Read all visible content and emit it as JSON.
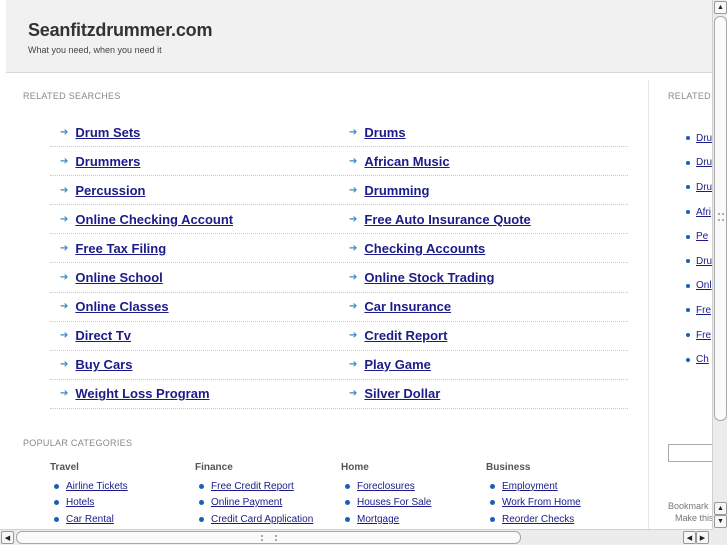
{
  "header": {
    "title": "Seanfitzdrummer.com",
    "tagline": "What you need, when you need it"
  },
  "related_searches": {
    "label": "RELATED SEARCHES",
    "rows": [
      [
        "Drum Sets",
        "Drums"
      ],
      [
        "Drummers",
        "African Music"
      ],
      [
        "Percussion",
        "Drumming"
      ],
      [
        "Online Checking Account",
        "Free Auto Insurance Quote"
      ],
      [
        "Free Tax Filing",
        "Checking Accounts"
      ],
      [
        "Online School",
        "Online Stock Trading"
      ],
      [
        "Online Classes",
        "Car Insurance"
      ],
      [
        "Direct Tv",
        "Credit Report"
      ],
      [
        "Buy Cars",
        "Play Game"
      ],
      [
        "Weight Loss Program",
        "Silver Dollar"
      ]
    ]
  },
  "popular_categories": {
    "label": "POPULAR CATEGORIES",
    "categories": [
      {
        "title": "Travel",
        "items": [
          "Airline Tickets",
          "Hotels",
          "Car Rental"
        ]
      },
      {
        "title": "Finance",
        "items": [
          "Free Credit Report",
          "Online Payment",
          "Credit Card Application"
        ]
      },
      {
        "title": "Home",
        "items": [
          "Foreclosures",
          "Houses For Sale",
          "Mortgage"
        ]
      },
      {
        "title": "Business",
        "items": [
          "Employment",
          "Work From Home",
          "Reorder Checks"
        ]
      }
    ]
  },
  "sidebar": {
    "label": "RELATED",
    "items": [
      "Dru",
      "Dru",
      "Dru",
      "Afri",
      "Pe",
      "Dru",
      "Onl",
      "Fre",
      "Fre",
      "Ch"
    ],
    "bookmark_line1": "Bookmark",
    "bookmark_line2": "Make this"
  },
  "colors": {
    "link": "#1b1b8a",
    "arrow": "#3a8abd",
    "header_bg": "#f1f1f1"
  }
}
